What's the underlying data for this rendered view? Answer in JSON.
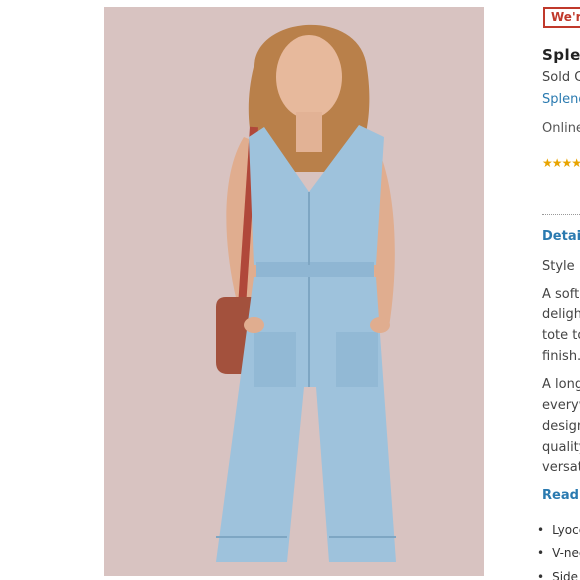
{
  "product": {
    "badge": "We're",
    "title": "Splen",
    "color": "Sold C",
    "brand": "Splend",
    "availability": "Online",
    "rating_stars": "★★★★",
    "details_heading": "Details",
    "style_no": "Style N",
    "description_lines": [
      "A softe",
      "deligh",
      "tote to",
      "finish.",
      "A long",
      "everyw",
      "design",
      "quality",
      "versati"
    ],
    "read_more": "Read M",
    "bullets": [
      "Lyoce",
      "V-nec",
      "Side"
    ]
  },
  "colors": {
    "accent_red": "#c0392b",
    "link_blue": "#2a7ab0",
    "star_gold": "#e8a400",
    "photo_backdrop": "#d8c3c1",
    "denim": "#9ec2dc"
  }
}
